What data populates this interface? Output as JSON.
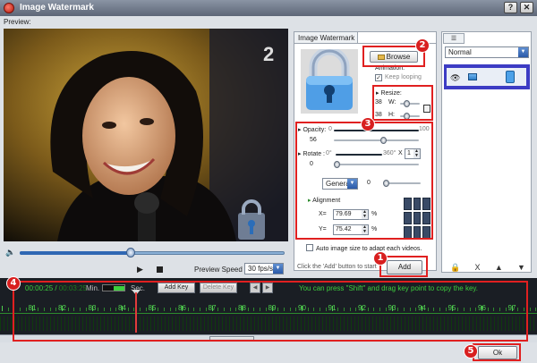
{
  "window": {
    "title": "Image Watermark",
    "help_label": "?",
    "close_label": "✕"
  },
  "preview": {
    "label": "Preview:",
    "speed_label": "Preview Speed",
    "speed_value": "30 fps/s",
    "seek_progress": 0.42
  },
  "watermark_panel": {
    "tab_label": "Image Watermark",
    "browse_label": "Browse",
    "animation_label": "Animation:",
    "keep_looping_label": "Keep looping",
    "resize_label": "Resize:",
    "width_label": "W:",
    "height_label": "H:",
    "width_value": "38",
    "height_value": "38",
    "opacity_label": "Opacity:",
    "opacity_min": "0",
    "opacity_max": "100",
    "opacity_value": "56",
    "rotate_label": "Rotate :",
    "rotate_min": "0°",
    "rotate_max": "360°",
    "rotate_mult_label": "X",
    "rotate_mult_value": "1",
    "rotate_value": "0",
    "blend_mode": "General",
    "blend_value": "0",
    "alignment_label": "Alignment",
    "x_label": "X=",
    "x_value": "79.69",
    "y_label": "Y=",
    "y_value": "75.42",
    "percent": "%",
    "auto_size_label": "Auto image size to adapt each videos.",
    "click_add_label": "Click the 'Add' button to start",
    "add_label": "Add"
  },
  "layers": {
    "blend_mode": "Normal",
    "tools": [
      "🔒",
      "X",
      "▲",
      "▼"
    ]
  },
  "timeline": {
    "current_time": "00:00:25",
    "total_time": "00:03:25",
    "separator": "/",
    "min_label": "Min.",
    "sec_label": "Sec.",
    "add_key_label": "Add Key",
    "delete_key_label": "Delete Key",
    "hint": "You can press \"Shift\" and drag key point to copy the key.",
    "ruler_labels": [
      "81",
      "82",
      "83",
      "84",
      "85",
      "86",
      "87",
      "88",
      "89",
      "90",
      "91",
      "92",
      "93",
      "94",
      "95",
      "96",
      "97",
      "98"
    ]
  },
  "ok_label": "Ok",
  "callouts": [
    "1",
    "2",
    "3",
    "4",
    "5"
  ],
  "colors": {
    "highlight": "#e02020",
    "timeline_green": "#3dcf3d",
    "selection_blue": "#3d3cc4"
  }
}
